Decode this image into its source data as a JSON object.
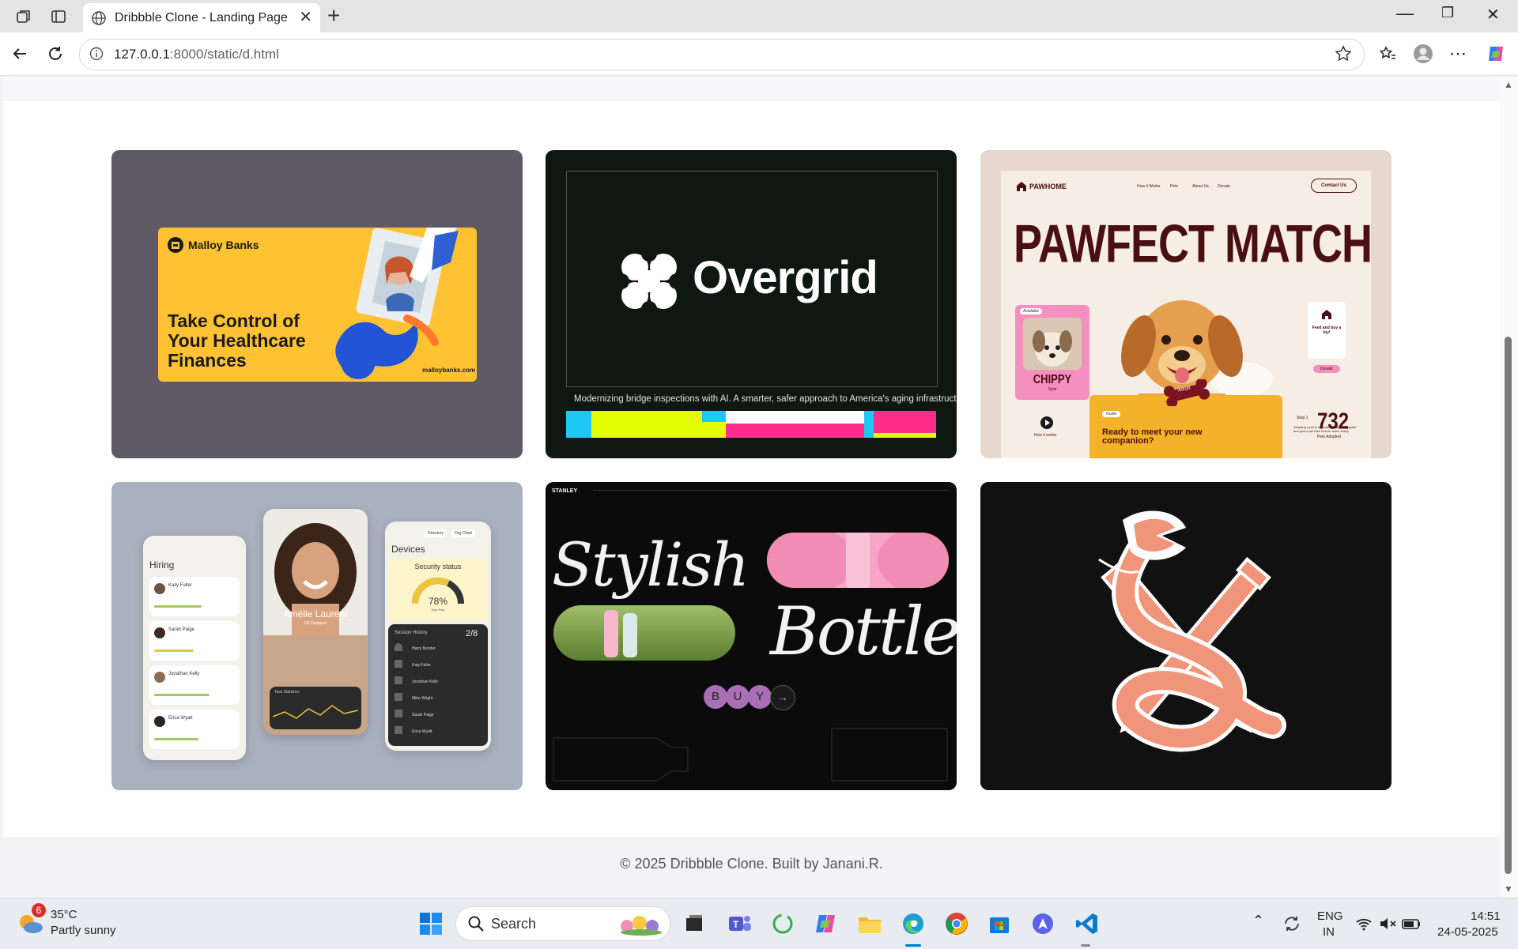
{
  "browser": {
    "tab_title": "Dribbble Clone - Landing Page",
    "url_host": "127.0.0.1",
    "url_rest": ":8000/static/d.html"
  },
  "cards": [
    {
      "id": "malloy",
      "bg": "#5f5a66",
      "brand": "Malloy Banks",
      "headline": [
        "Take Control of",
        "Your Healthcare",
        "Finances"
      ],
      "site": "malloybanks.com"
    },
    {
      "id": "overgrid",
      "bg": "#0f1712",
      "logo_text": "Overgrid",
      "caption": "Modernizing bridge inspections with AI. A smarter, safer approach to America's aging infrastructure."
    },
    {
      "id": "pawhome",
      "bg": "#e6d8cf",
      "brand": "PAWHOME",
      "nav": [
        "How it Works",
        "Pets",
        "About Us",
        "Donate"
      ],
      "cta": "Contact Us",
      "headline": "PAWFECT MATCH",
      "pet_badge": "Available",
      "pet_name": "CHIPPY",
      "pet_sub": "Style",
      "side_text": "Feed and buy a toy!",
      "side_btn": "Donate",
      "bone_label": "Adopt",
      "guide": "Guide",
      "panel_title": "Ready to meet your new companion?",
      "how": "How it works",
      "step": "Step 1",
      "stat": "732",
      "stat_label": "Pets Adopted",
      "desc": "Adopting a pet is rewarding. Match our guide and give a pet their forever home today."
    },
    {
      "id": "hiring",
      "bg": "#a9b0be",
      "left_title": "Hiring",
      "people": [
        "Kaily Fuller",
        "Sarah Paige",
        "Jonathan Kelly",
        "Erica Wyatt"
      ],
      "profile_name": "Amélie Laurent",
      "profile_role": "UX Designer",
      "chart_label": "Task Statistics",
      "right_title": "Devices",
      "tabs": [
        "Directory",
        "Org Chart"
      ],
      "security_label": "Security status",
      "security_value": "78%",
      "security_sub": "High Risk",
      "session_label": "Session History",
      "session_count": "2/8",
      "sessions": [
        "Harry Bender",
        "Katy Fuller",
        "Jonathan Kelly",
        "Mike Wright",
        "Sarah Paige",
        "Erica Wyatt"
      ]
    },
    {
      "id": "stanley",
      "bg": "#0b0b0b",
      "brand": "STANLEY",
      "word1": "Stylish",
      "word2": "Bottle",
      "buy": [
        "B",
        "U",
        "Y"
      ]
    },
    {
      "id": "snake",
      "bg": "#111111"
    }
  ],
  "footer": {
    "text": "© 2025 Dribbble Clone. Built by Janani.R."
  },
  "taskbar": {
    "weather_temp": "35°C",
    "weather_desc": "Partly sunny",
    "weather_badge": "6",
    "search_label": "Search",
    "lang_top": "ENG",
    "lang_bottom": "IN",
    "time": "14:51",
    "date": "24-05-2025"
  },
  "colors": {
    "accent_edge": "#0078d4",
    "malloy_yellow": "#ffc233",
    "overgrid_pink": "#ff2d8b",
    "overgrid_lime": "#e4ff00",
    "overgrid_cyan": "#1ec8f2",
    "paw_brown": "#4a0f12",
    "snake_salmon": "#f0957a"
  }
}
